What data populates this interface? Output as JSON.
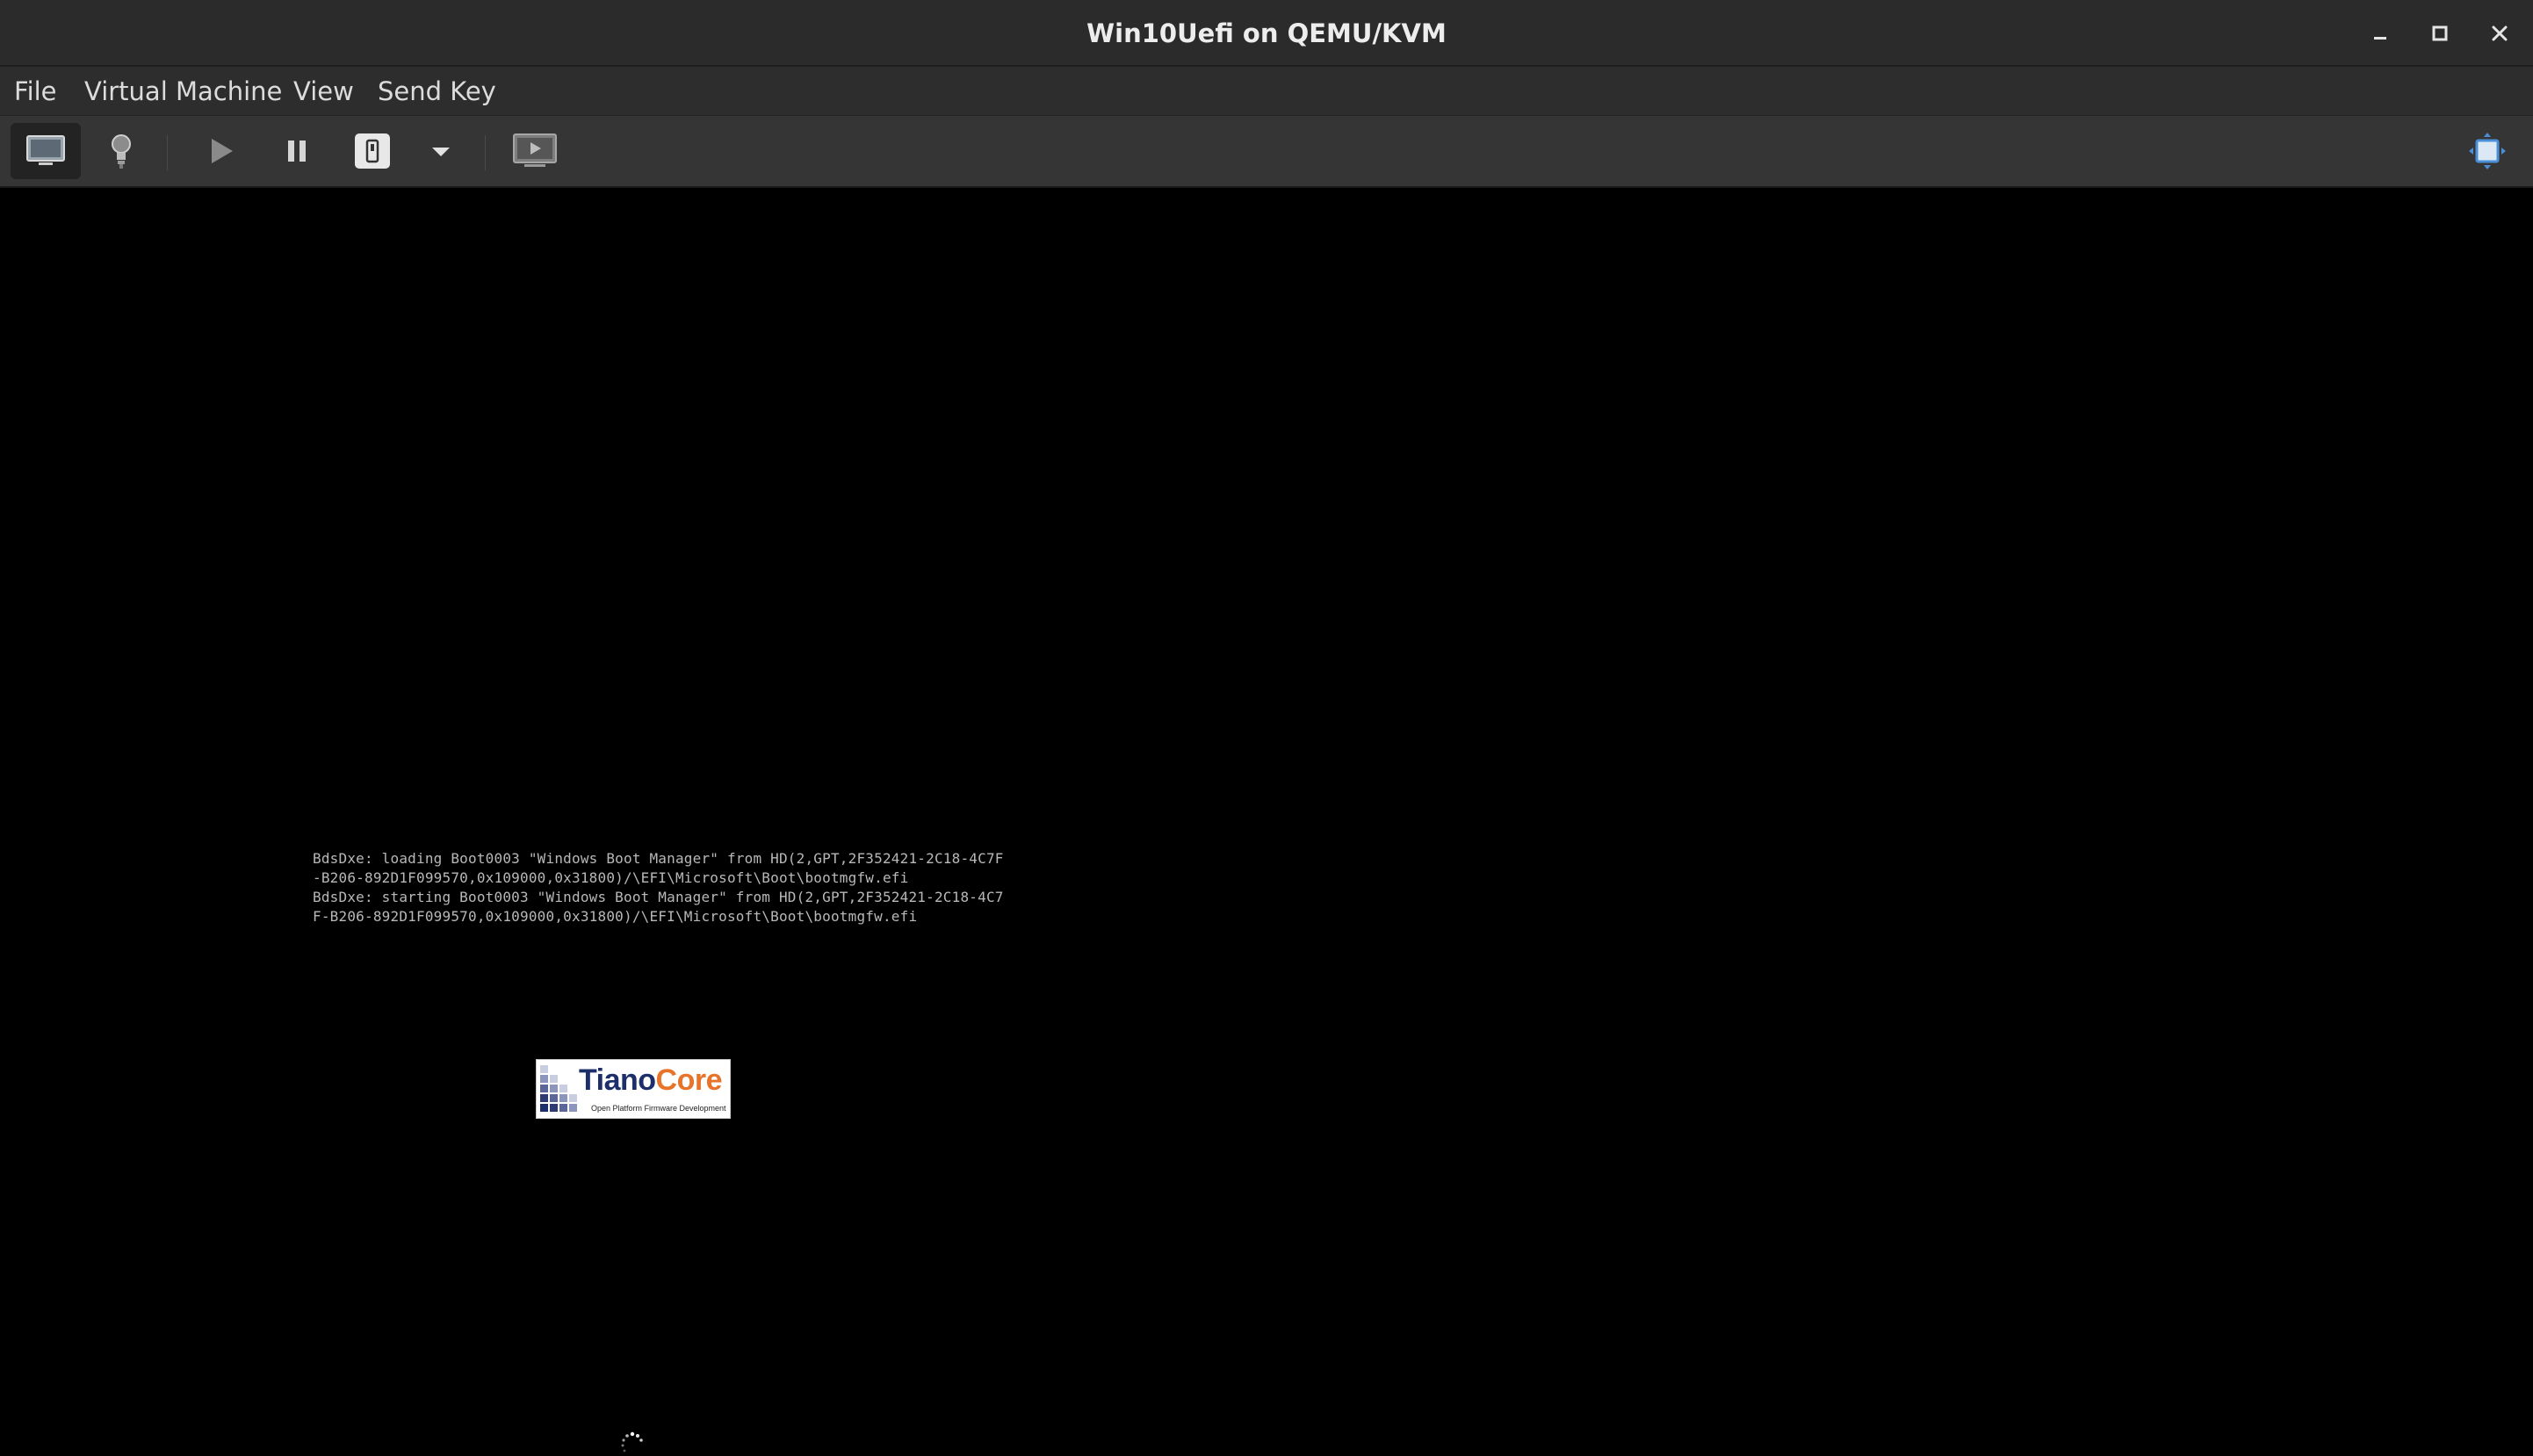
{
  "window": {
    "title": "Win10Uefi on QEMU/KVM",
    "controls": [
      "minimize-icon",
      "maximize-icon",
      "close-icon"
    ]
  },
  "menubar": {
    "items": [
      "File",
      "Virtual Machine",
      "View",
      "Send Key"
    ]
  },
  "toolbar": {
    "buttons": [
      {
        "icon": "monitor-icon",
        "state": "active"
      },
      {
        "icon": "lightbulb-icon"
      },
      {
        "icon": "play-icon"
      },
      {
        "icon": "pause-icon"
      },
      {
        "icon": "power-icon"
      },
      {
        "icon": "chevron-down-icon"
      },
      {
        "icon": "snapshot-icon"
      },
      {
        "icon": "fullscreen-icon"
      }
    ]
  },
  "console": {
    "lines": [
      "BdsDxe: loading Boot0003 \"Windows Boot Manager\" from HD(2,GPT,2F352421-2C18-4C7F",
      "-B206-892D1F099570,0x109000,0x31800)/\\EFI\\Microsoft\\Boot\\bootmgfw.efi",
      "BdsDxe: starting Boot0003 \"Windows Boot Manager\" from HD(2,GPT,2F352421-2C18-4C7",
      "F-B206-892D1F099570,0x109000,0x31800)/\\EFI\\Microsoft\\Boot\\bootmgfw.efi"
    ]
  },
  "logo": {
    "name_part1": "Tiano",
    "name_part2": "Core",
    "tagline": "Open Platform Firmware Development",
    "colors": {
      "tiano": "#1d2f6b",
      "core": "#e8742c"
    }
  },
  "colors": {
    "titlebar": "#2b2b2b",
    "menubar": "#2d2d2d",
    "toolbar": "#353535",
    "display": "#000000",
    "text": "#dcdcdc"
  }
}
